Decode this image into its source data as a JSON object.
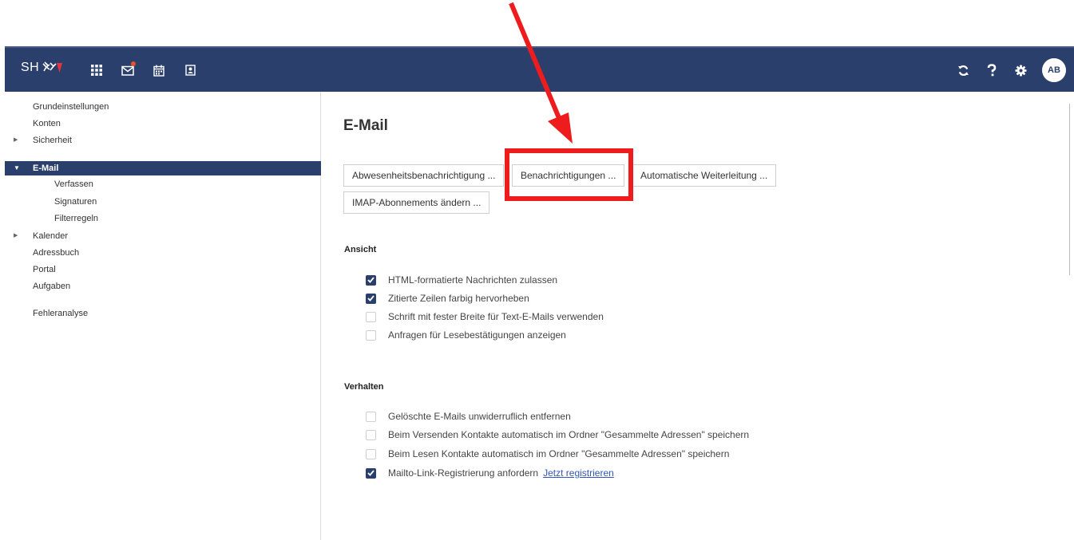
{
  "colors": {
    "topbar": "#2b3f6c",
    "accent_active": "#2b3f6c",
    "link": "#3057b5",
    "annotation_red": "#ee1c1c"
  },
  "topbar": {
    "brand_text": "SH",
    "left_icons": [
      "apps-grid-icon",
      "mail-icon",
      "calendar-icon",
      "contacts-icon"
    ],
    "right_icons": [
      "refresh-icon",
      "help-icon",
      "settings-gear-icon"
    ],
    "avatar_initials": "AB"
  },
  "sidebar": {
    "items": [
      {
        "label": "Grundeinstellungen"
      },
      {
        "label": "Konten"
      },
      {
        "label": "Sicherheit"
      },
      {
        "label": "E-Mail"
      },
      {
        "label": "Verfassen"
      },
      {
        "label": "Signaturen"
      },
      {
        "label": "Filterregeln"
      },
      {
        "label": "Kalender"
      },
      {
        "label": "Adressbuch"
      },
      {
        "label": "Portal"
      },
      {
        "label": "Aufgaben"
      },
      {
        "label": "Fehleranalyse"
      }
    ]
  },
  "main": {
    "title": "E-Mail",
    "buttons": [
      {
        "label": "Abwesenheitsbenachrichtigung ..."
      },
      {
        "label": "Benachrichtigungen ..."
      },
      {
        "label": "Automatische Weiterleitung ..."
      },
      {
        "label": "IMAP-Abonnements ändern ..."
      }
    ],
    "sections": [
      {
        "title": "Ansicht",
        "options": [
          {
            "label": "HTML-formatierte Nachrichten zulassen",
            "checked": true
          },
          {
            "label": "Zitierte Zeilen farbig hervorheben",
            "checked": true
          },
          {
            "label": "Schrift mit fester Breite für Text-E-Mails verwenden",
            "checked": false
          },
          {
            "label": "Anfragen für Lesebestätigungen anzeigen",
            "checked": false
          }
        ]
      },
      {
        "title": "Verhalten",
        "options": [
          {
            "label": "Gelöschte E-Mails unwiderruflich entfernen",
            "checked": false
          },
          {
            "label": "Beim Versenden Kontakte automatisch im Ordner \"Gesammelte Adressen\" speichern",
            "checked": false
          },
          {
            "label": "Beim Lesen Kontakte automatisch im Ordner \"Gesammelte Adressen\" speichern",
            "checked": false
          },
          {
            "label": "Mailto-Link-Registrierung anfordern",
            "checked": true,
            "link": "Jetzt registrieren"
          }
        ]
      }
    ]
  }
}
